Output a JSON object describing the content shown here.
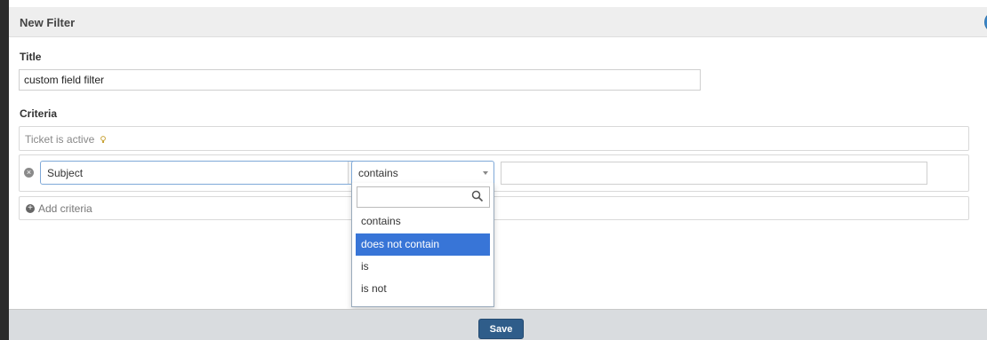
{
  "dialog": {
    "title": "New Filter",
    "close_symbol": "×"
  },
  "form": {
    "title_label": "Title",
    "title_value": "custom field filter",
    "criteria_label": "Criteria",
    "default_criterion": "Ticket is active",
    "criteria_row": {
      "field": "Subject",
      "operator": "contains",
      "value": ""
    },
    "add_criteria_label": "Add criteria"
  },
  "operator_dropdown": {
    "search_value": "",
    "options": [
      "contains",
      "does not contain",
      "is",
      "is not"
    ],
    "highlighted": "does not contain"
  },
  "footer": {
    "save_label": "Save"
  },
  "icons": {
    "close": "close-icon",
    "bulb": "lightbulb-icon",
    "remove": "remove-circle-icon",
    "add": "plus-circle-icon",
    "search": "search-icon",
    "caret": "chevron-down-icon"
  },
  "colors": {
    "accent": "#3875d7",
    "save_button": "#2f5d8a",
    "close_button": "#3a86c8"
  }
}
